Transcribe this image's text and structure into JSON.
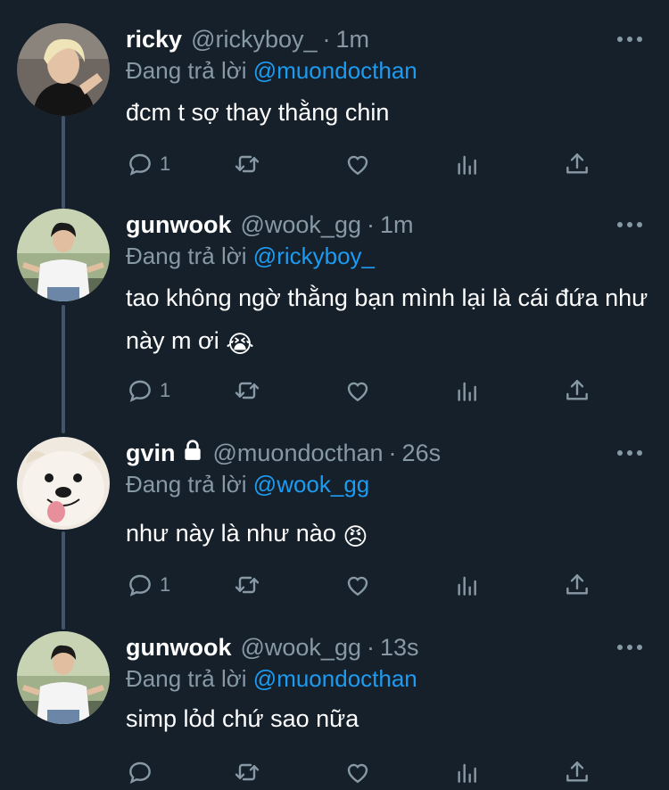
{
  "reply_prefix": "Đang trả lời",
  "tweets": [
    {
      "name": "ricky",
      "handle": "@rickyboy_",
      "time": "1m",
      "reply_to": "@muondocthan",
      "text": "đcm t sợ thay thằng chin",
      "text_suffix": "",
      "reply_count": "1",
      "avatar": "photo-blonde-guy"
    },
    {
      "name": "gunwook",
      "handle": "@wook_gg",
      "time": "1m",
      "reply_to": "@rickyboy_",
      "text": "tao không ngờ thằng bạn mình lại là cái đứa như này m ơi",
      "text_suffix": "😭",
      "reply_count": "1",
      "avatar": "photo-guy-white-shirt"
    },
    {
      "name": "gvin",
      "handle": "@muondocthan",
      "time": "26s",
      "reply_to": "@wook_gg",
      "text": "như này là như nào",
      "text_suffix": "😠",
      "reply_count": "1",
      "avatar": "photo-dog",
      "locked": true
    },
    {
      "name": "gunwook",
      "handle": "@wook_gg",
      "time": "13s",
      "reply_to": "@muondocthan",
      "text": "simp lỏd chứ sao nữa",
      "text_suffix": "",
      "reply_count": "",
      "avatar": "photo-guy-white-shirt"
    }
  ],
  "icons": {
    "reply": "reply-icon",
    "retweet": "retweet-icon",
    "like": "heart-icon",
    "analytics": "analytics-icon",
    "share": "share-icon",
    "more": "more-icon",
    "lock": "lock-icon"
  },
  "colors": {
    "background": "#15202b",
    "secondary_text": "#8899a6",
    "mention": "#1d9bf0",
    "thread_line": "#42536a"
  }
}
